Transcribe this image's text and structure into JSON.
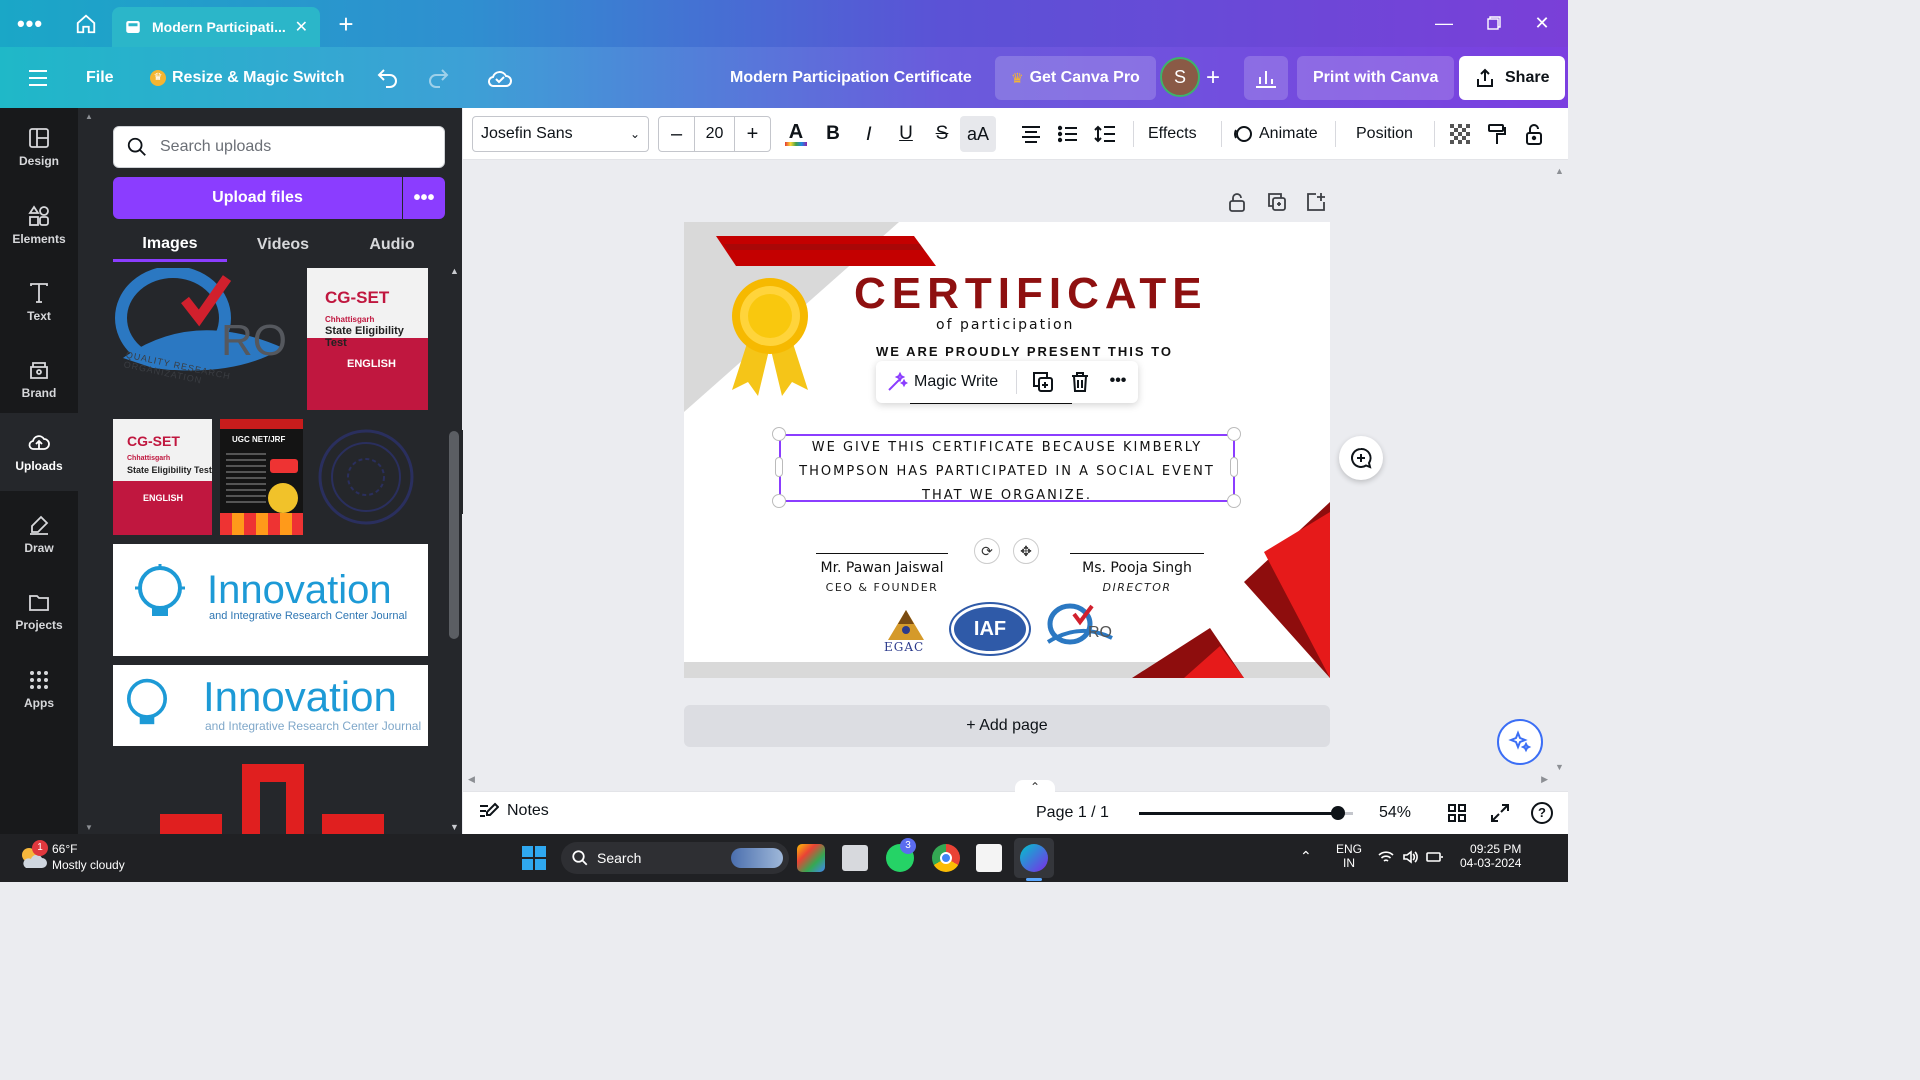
{
  "browser": {
    "tab_title": "Modern Participati...",
    "new_tab_label": "+"
  },
  "menubar": {
    "file": "File",
    "resize": "Resize & Magic Switch",
    "doc_title": "Modern Participation Certificate",
    "get_pro": "Get Canva Pro",
    "avatar_initial": "S",
    "print": "Print with Canva",
    "share": "Share"
  },
  "rail": [
    {
      "label": "Design",
      "icon": "design-icon"
    },
    {
      "label": "Elements",
      "icon": "elements-icon"
    },
    {
      "label": "Text",
      "icon": "text-icon"
    },
    {
      "label": "Brand",
      "icon": "brand-icon"
    },
    {
      "label": "Uploads",
      "icon": "uploads-icon"
    },
    {
      "label": "Draw",
      "icon": "draw-icon"
    },
    {
      "label": "Projects",
      "icon": "projects-icon"
    },
    {
      "label": "Apps",
      "icon": "apps-icon"
    }
  ],
  "panel": {
    "search_placeholder": "Search uploads",
    "upload_button": "Upload files",
    "tabs": [
      "Images",
      "Videos",
      "Audio"
    ],
    "thumbs": {
      "cgset_title": "CG-SET",
      "cgset_sub1": "Chhattisgarh",
      "cgset_sub2": "State Eligibility Test",
      "cgset_lang": "ENGLISH",
      "ugc_title": "UGC NET/JRF",
      "innovation_word": "Innovation",
      "innovation_sub": "and Integrative Research Center Journal",
      "qro_letters": "RO",
      "qro_caption": "QUALITY RESEARCH ORGANIZATION"
    }
  },
  "toolbar": {
    "font": "Josefin Sans",
    "font_size": "20",
    "minus": "–",
    "plus": "+",
    "bold": "B",
    "italic": "I",
    "underline": "U",
    "strike": "S",
    "case": "aA",
    "effects": "Effects",
    "animate": "Animate",
    "position": "Position"
  },
  "certificate": {
    "title": "CERTIFICATE",
    "subtitle": "of participation",
    "present": "WE ARE PROUDLY PRESENT THIS TO",
    "body": "WE GIVE THIS CERTIFICATE BECAUSE KIMBERLY THOMPSON HAS PARTICIPATED IN A SOCIAL EVENT THAT WE ORGANIZE.",
    "sign1_name": "Mr. Pawan Jaiswal",
    "sign1_role": "CEO & FOUNDER",
    "sign2_name": "Ms. Pooja Singh",
    "sign2_role": "DIRECTOR",
    "logo_egac": "EGAC",
    "logo_iaf": "IAF",
    "logo_qro": "RO"
  },
  "context_menu": {
    "magic_write": "Magic Write"
  },
  "canvas": {
    "add_page": "+ Add page"
  },
  "bottombar": {
    "notes": "Notes",
    "page": "Page 1 / 1",
    "zoom": "54%",
    "zoom_level": 0.54
  },
  "taskbar": {
    "temp": "66°F",
    "weather": "Mostly cloudy",
    "weather_badge": "1",
    "search": "Search",
    "whatsapp_badge": "3",
    "lang1": "ENG",
    "lang2": "IN",
    "time": "09:25 PM",
    "date": "04-03-2024"
  },
  "colors": {
    "accent": "#8b3dff",
    "cert_red": "#c40000",
    "cert_dark_red": "#8e0d0d",
    "cert_title": "#8e1010"
  }
}
